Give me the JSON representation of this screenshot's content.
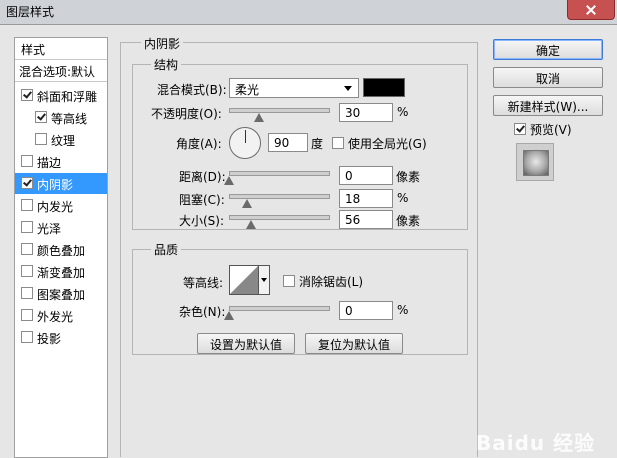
{
  "window": {
    "title": "图层样式"
  },
  "left_panel": {
    "header": "样式",
    "blend_options": "混合选项:默认",
    "items": [
      {
        "label": "斜面和浮雕",
        "checked": true,
        "indent": false
      },
      {
        "label": "等高线",
        "checked": true,
        "indent": true
      },
      {
        "label": "纹理",
        "checked": false,
        "indent": true
      },
      {
        "label": "描边",
        "checked": false,
        "indent": false
      },
      {
        "label": "内阴影",
        "checked": true,
        "indent": false,
        "selected": true
      },
      {
        "label": "内发光",
        "checked": false,
        "indent": false
      },
      {
        "label": "光泽",
        "checked": false,
        "indent": false
      },
      {
        "label": "颜色叠加",
        "checked": false,
        "indent": false
      },
      {
        "label": "渐变叠加",
        "checked": false,
        "indent": false
      },
      {
        "label": "图案叠加",
        "checked": false,
        "indent": false
      },
      {
        "label": "外发光",
        "checked": false,
        "indent": false
      },
      {
        "label": "投影",
        "checked": false,
        "indent": false
      }
    ]
  },
  "panel": {
    "title": "内阴影",
    "structure": {
      "title": "结构",
      "blend_mode_label": "混合模式(B):",
      "blend_mode_value": "柔光",
      "blend_color": "#000000",
      "opacity_label": "不透明度(O):",
      "opacity_value": "30",
      "opacity_unit": "%",
      "opacity_level": 0.3,
      "angle_label": "角度(A):",
      "angle_value": "90",
      "angle_unit": "度",
      "global_light_label": "使用全局光(G)",
      "global_light_checked": false,
      "distance_label": "距离(D):",
      "distance_value": "0",
      "distance_unit": "像素",
      "distance_level": 0.0,
      "choke_label": "阻塞(C):",
      "choke_value": "18",
      "choke_unit": "%",
      "choke_level": 0.18,
      "size_label": "大小(S):",
      "size_value": "56",
      "size_unit": "像素",
      "size_level": 0.22
    },
    "quality": {
      "title": "品质",
      "contour_label": "等高线:",
      "antialias_label": "消除锯齿(L)",
      "antialias_checked": false,
      "noise_label": "杂色(N):",
      "noise_value": "0",
      "noise_unit": "%",
      "noise_level": 0.0
    },
    "buttons": {
      "set_default": "设置为默认值",
      "reset_default": "复位为默认值"
    }
  },
  "right": {
    "ok": "确定",
    "cancel": "取消",
    "new_style": "新建样式(W)...",
    "preview_label": "预览(V)",
    "preview_checked": true
  },
  "watermark": "Baidu 经验"
}
